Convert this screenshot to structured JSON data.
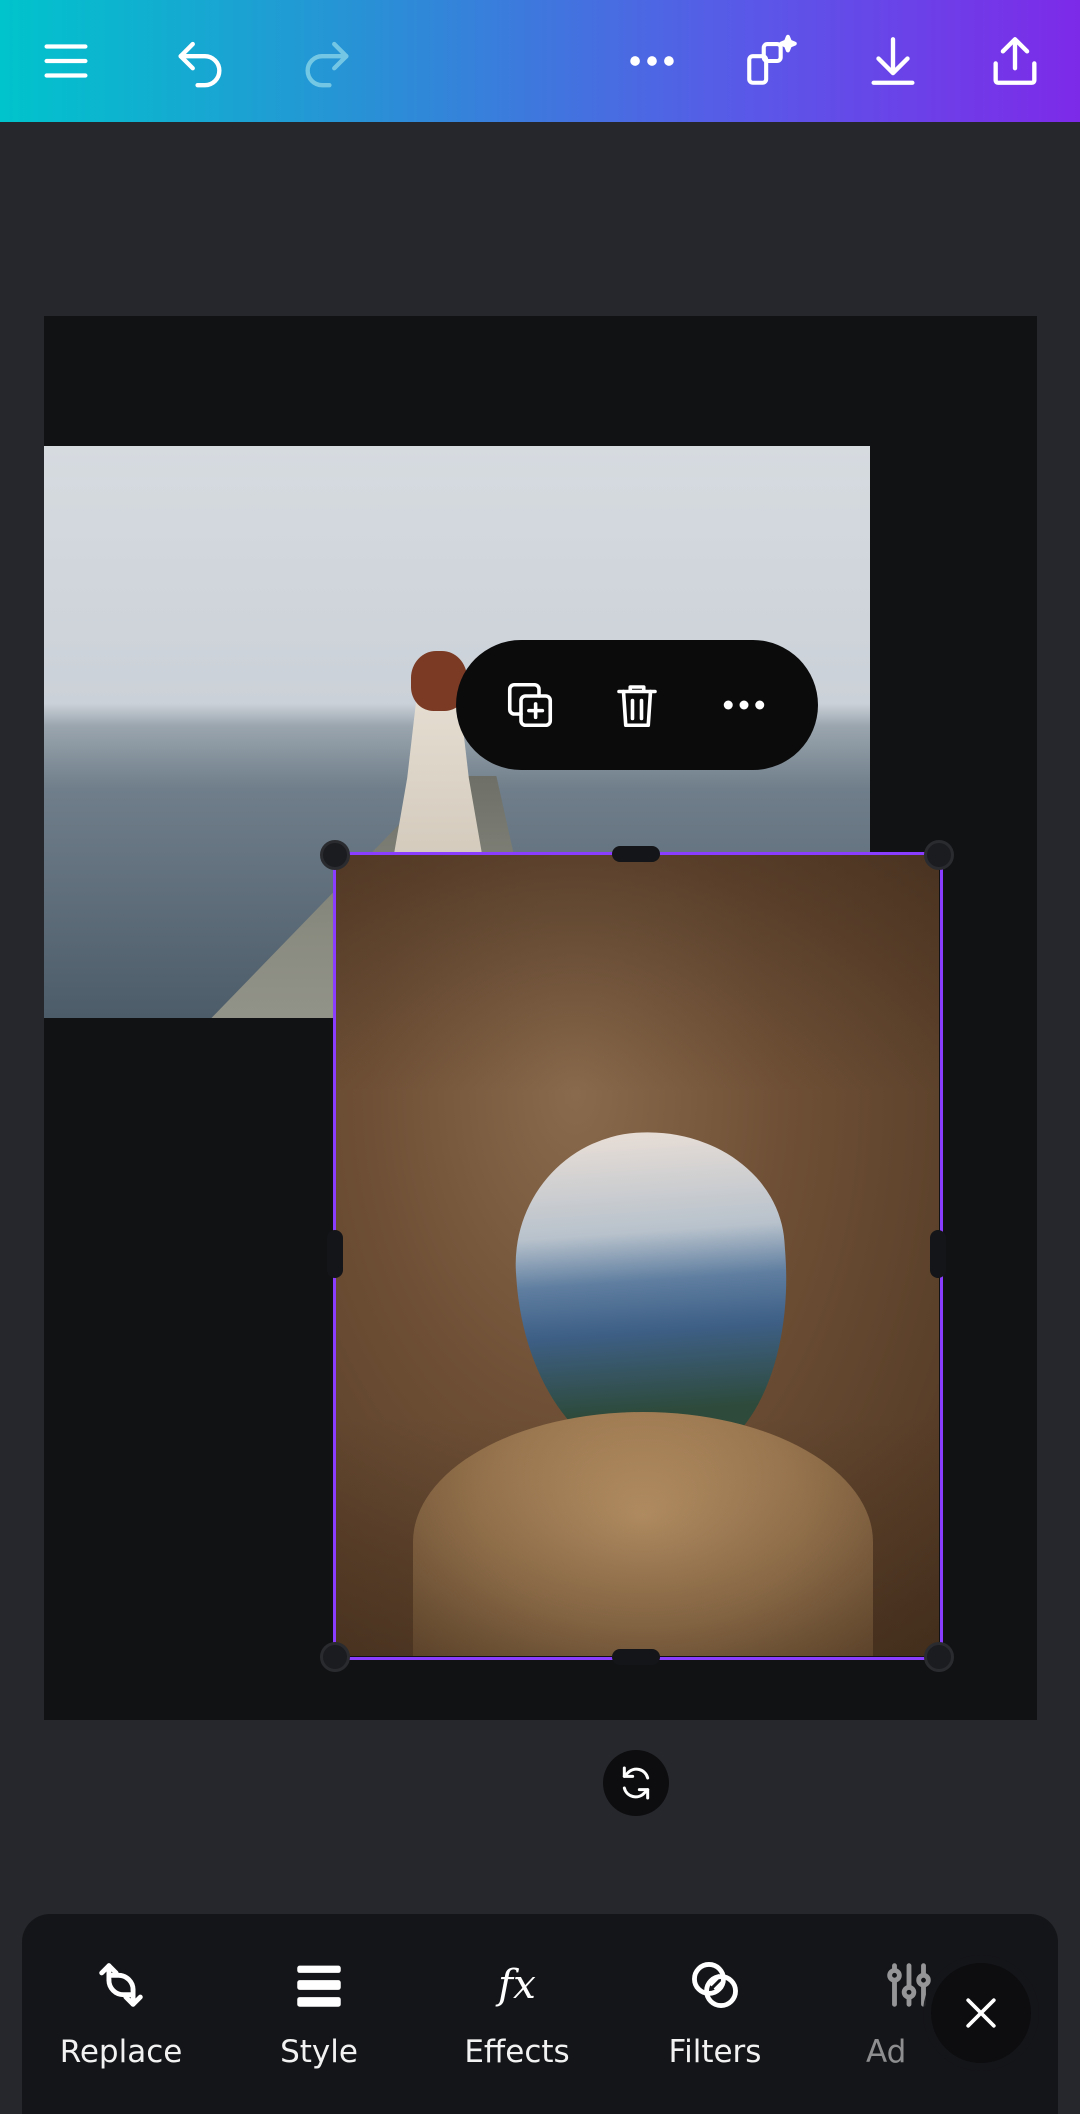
{
  "topbar": {
    "icons": [
      "menu-icon",
      "undo-icon",
      "redo-icon",
      "more-icon",
      "magic-resize-icon",
      "download-icon",
      "share-icon"
    ]
  },
  "context_menu": {
    "icons": [
      "duplicate-icon",
      "delete-icon",
      "more-icon"
    ]
  },
  "toolbar": {
    "tools": [
      {
        "label": "Replace",
        "icon": "replace-icon"
      },
      {
        "label": "Style",
        "icon": "style-icon"
      },
      {
        "label": "Effects",
        "icon": "effects-icon"
      },
      {
        "label": "Filters",
        "icon": "filters-icon"
      },
      {
        "label": "Ad",
        "icon": "adjust-icon"
      }
    ]
  },
  "colors": {
    "gradient_start": "#00c4cc",
    "gradient_end": "#7d2ae8",
    "selection": "#8b3dff",
    "background": "#25272c",
    "canvas": "#111214"
  }
}
